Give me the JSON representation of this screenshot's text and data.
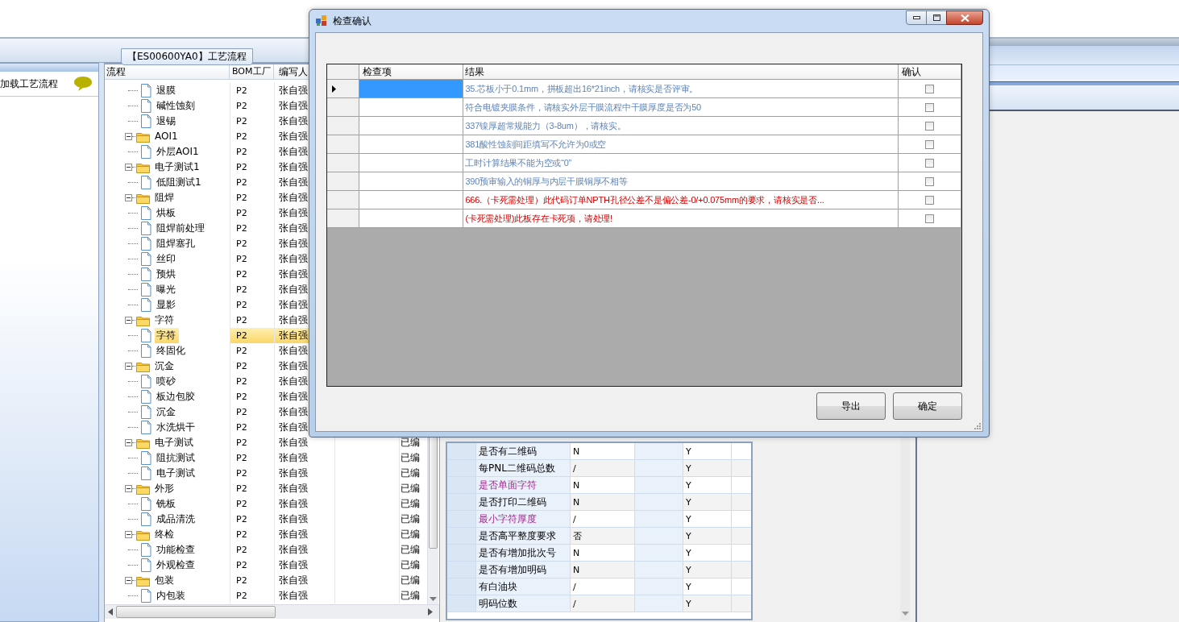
{
  "app": {
    "tab": "【ES00600YA0】工艺流程",
    "load_panel": {
      "label": "加载工艺流程"
    }
  },
  "process_tree": {
    "columns": [
      "流程",
      "BOM工厂",
      "编写人"
    ],
    "groups": [
      {
        "children": [
          {
            "label": "退膜",
            "plant": "P2",
            "author": "张自强",
            "selected": false
          },
          {
            "label": "碱性蚀刻",
            "plant": "P2",
            "author": "张自强",
            "selected": false
          },
          {
            "label": "退锡",
            "plant": "P2",
            "author": "张自强",
            "selected": false
          }
        ]
      },
      {
        "label": "AOI1",
        "plant": "P2",
        "author": "张自强",
        "selected": false,
        "expanded": true,
        "children": [
          {
            "label": "外层AOI1",
            "plant": "P2",
            "author": "张自强",
            "selected": false
          }
        ]
      },
      {
        "label": "电子测试1",
        "plant": "P2",
        "author": "张自强",
        "selected": false,
        "expanded": true,
        "children": [
          {
            "label": "低阻测试1",
            "plant": "P2",
            "author": "张自强",
            "selected": false
          }
        ]
      },
      {
        "label": "阻焊",
        "plant": "P2",
        "author": "张自强",
        "selected": false,
        "expanded": true,
        "children": [
          {
            "label": "烘板",
            "plant": "P2",
            "author": "张自强",
            "selected": false
          },
          {
            "label": "阻焊前处理",
            "plant": "P2",
            "author": "张自强",
            "selected": false
          },
          {
            "label": "阻焊塞孔",
            "plant": "P2",
            "author": "张自强",
            "selected": false
          },
          {
            "label": "丝印",
            "plant": "P2",
            "author": "张自强",
            "selected": false
          },
          {
            "label": "预烘",
            "plant": "P2",
            "author": "张自强",
            "selected": false
          },
          {
            "label": "曝光",
            "plant": "P2",
            "author": "张自强",
            "selected": false
          },
          {
            "label": "显影",
            "plant": "P2",
            "author": "张自强",
            "selected": false
          }
        ]
      },
      {
        "label": "字符",
        "plant": "P2",
        "author": "张自强",
        "selected": false,
        "expanded": true,
        "children": [
          {
            "label": "字符",
            "plant": "P2",
            "author": "张自强",
            "selected": true
          },
          {
            "label": "终固化",
            "plant": "P2",
            "author": "张自强",
            "selected": false
          }
        ]
      },
      {
        "label": "沉金",
        "plant": "P2",
        "author": "张自强",
        "selected": false,
        "expanded": true,
        "children": [
          {
            "label": "喷砂",
            "plant": "P2",
            "author": "张自强",
            "selected": false
          },
          {
            "label": "板边包胶",
            "plant": "P2",
            "author": "张自强",
            "selected": false
          },
          {
            "label": "沉金",
            "plant": "P2",
            "author": "张自强",
            "selected": false
          },
          {
            "label": "水洗烘干",
            "plant": "P2",
            "author": "张自强",
            "selected": false
          }
        ]
      },
      {
        "label": "电子测试",
        "plant": "P2",
        "author": "张自强",
        "status": "已编",
        "selected": false,
        "expanded": true,
        "children": [
          {
            "label": "阻抗测试",
            "plant": "P2",
            "author": "张自强",
            "status": "已编",
            "selected": false
          },
          {
            "label": "电子测试",
            "plant": "P2",
            "author": "张自强",
            "status": "已编",
            "selected": false
          }
        ]
      },
      {
        "label": "外形",
        "plant": "P2",
        "author": "张自强",
        "status": "已编",
        "selected": false,
        "expanded": true,
        "children": [
          {
            "label": "铣板",
            "plant": "P2",
            "author": "张自强",
            "status": "已编",
            "selected": false
          },
          {
            "label": "成品清洗",
            "plant": "P2",
            "author": "张自强",
            "status": "已编",
            "selected": false
          }
        ]
      },
      {
        "label": "终检",
        "plant": "P2",
        "author": "张自强",
        "status": "已编",
        "selected": false,
        "expanded": true,
        "children": [
          {
            "label": "功能检查",
            "plant": "P2",
            "author": "张自强",
            "status": "已编",
            "selected": false
          },
          {
            "label": "外观检查",
            "plant": "P2",
            "author": "张自强",
            "status": "已编",
            "selected": false
          }
        ]
      },
      {
        "label": "包装",
        "plant": "P2",
        "author": "张自强",
        "status": "已编",
        "selected": false,
        "expanded": true,
        "children": [
          {
            "label": "内包装",
            "plant": "P2",
            "author": "张自强",
            "status": "已编",
            "selected": false
          }
        ]
      }
    ]
  },
  "parameter_grid": {
    "rows": [
      {
        "name": "是否有二维码",
        "value": "N",
        "column_4": "Y",
        "highlighted": false
      },
      {
        "name": "每PNL二维码总数",
        "value": "/",
        "column_4": "Y",
        "highlighted": false
      },
      {
        "name": "是否单面字符",
        "value": "N",
        "column_4": "Y",
        "highlighted": true
      },
      {
        "name": "是否打印二维码",
        "value": "N",
        "column_4": "Y",
        "highlighted": false
      },
      {
        "name": "最小字符厚度",
        "value": "/",
        "column_4": "Y",
        "highlighted": true
      },
      {
        "name": "是否高平整度要求",
        "value": "否",
        "column_4": "Y",
        "highlighted": false
      },
      {
        "name": "是否有增加批次号",
        "value": "N",
        "column_4": "Y",
        "highlighted": false
      },
      {
        "name": "是否有增加明码",
        "value": "N",
        "column_4": "Y",
        "highlighted": false
      },
      {
        "name": "有白油块",
        "value": "/",
        "column_4": "Y",
        "highlighted": false
      },
      {
        "name": "明码位数",
        "value": "/",
        "column_4": "Y",
        "highlighted": false
      }
    ]
  },
  "dialog": {
    "title": "检查确认",
    "columns": [
      "检查项",
      "结果",
      "确认"
    ],
    "rows": [
      {
        "result": "35.芯板小于0.1mm，拼板超出16*21inch，请核实是否评审。",
        "highlighted": false,
        "checked": false,
        "selected": true
      },
      {
        "result": "符合电镀夹膜条件，请核实外层干膜流程中干膜厚度是否为50",
        "highlighted": false,
        "checked": false,
        "selected": false
      },
      {
        "result": "337镍厚超常规能力（3-8um），请核实。",
        "highlighted": false,
        "checked": false,
        "selected": false
      },
      {
        "result": "381酸性蚀刻间距填写不允许为0或空",
        "highlighted": false,
        "checked": false,
        "selected": false
      },
      {
        "result": "工时计算结果不能为空或“0”",
        "highlighted": false,
        "checked": false,
        "selected": false
      },
      {
        "result": "390预审输入的铜厚与内层干膜铜厚不相等",
        "highlighted": false,
        "checked": false,
        "selected": false
      },
      {
        "result": "666.（卡死需处理）此代码订单NPTH孔径公差不是偏公差-0/+0.075mm的要求，请核实是否...",
        "highlighted": true,
        "checked": false,
        "selected": false
      },
      {
        "result": "(卡死需处理)此板存在卡死项，请处理!",
        "highlighted": true,
        "checked": false,
        "selected": false
      }
    ],
    "buttons": [
      "导出",
      "确定"
    ]
  }
}
